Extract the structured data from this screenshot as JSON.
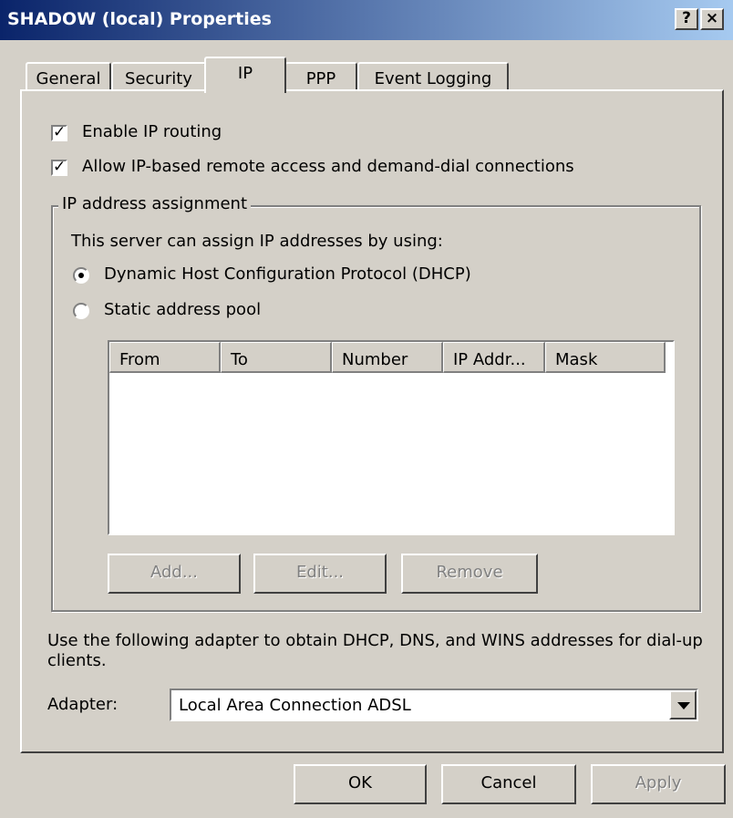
{
  "window": {
    "title": "SHADOW (local) Properties",
    "help_button": "?",
    "close_button": "×"
  },
  "tabs": [
    {
      "label": "General"
    },
    {
      "label": "Security"
    },
    {
      "label": "IP",
      "active": true
    },
    {
      "label": "PPP"
    },
    {
      "label": "Event Logging"
    }
  ],
  "options": {
    "enable_ip_routing": {
      "label": "Enable IP routing",
      "checked": true
    },
    "allow_ip_remote": {
      "label": "Allow IP-based remote access and demand-dial connections",
      "checked": true
    }
  },
  "ip_assignment": {
    "group_title": "IP address assignment",
    "intro": "This server can assign IP addresses by using:",
    "dhcp_label": "Dynamic Host Configuration Protocol (DHCP)",
    "static_label": "Static address pool",
    "selected": "dhcp",
    "columns": [
      "From",
      "To",
      "Number",
      "IP Addr...",
      "Mask"
    ],
    "rows": [],
    "buttons": {
      "add": "Add...",
      "edit": "Edit...",
      "remove": "Remove"
    }
  },
  "adapter": {
    "description": "Use the following adapter to obtain DHCP, DNS, and WINS addresses for dial-up clients.",
    "label": "Adapter:",
    "value": "Local Area Connection ADSL"
  },
  "footer": {
    "ok": "OK",
    "cancel": "Cancel",
    "apply": "Apply"
  },
  "colors": {
    "title_start": "#0a246a",
    "title_end": "#a6caf0",
    "face": "#d4d0c8"
  }
}
